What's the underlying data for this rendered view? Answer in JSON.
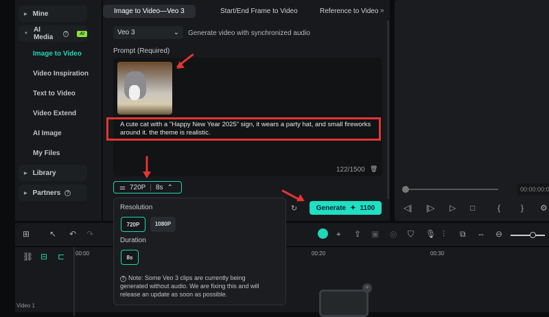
{
  "sidebar": {
    "groups": [
      {
        "label": "Mine"
      },
      {
        "label": "AI Media",
        "badge": "AI"
      },
      {
        "label": "Library"
      },
      {
        "label": "Partners"
      }
    ],
    "items": [
      {
        "label": "Image to Video"
      },
      {
        "label": "Video Inspiration"
      },
      {
        "label": "Text to Video"
      },
      {
        "label": "Video Extend"
      },
      {
        "label": "AI Image"
      },
      {
        "label": "My Files"
      }
    ]
  },
  "tabs": [
    {
      "label": "Image to Video—Veo 3"
    },
    {
      "label": "Start/End Frame to Video"
    },
    {
      "label": "Reference to Video"
    }
  ],
  "model": {
    "value": "Veo 3",
    "description": "Generate video with synchronized audio"
  },
  "prompt": {
    "label": "Prompt (Required)",
    "text": "A cute cat with a \"Happy New Year 2025\" sign, it wears a party hat, and small fireworks around it. the theme is realistic.",
    "counter": "122/1500"
  },
  "settings": {
    "resolution": "720P",
    "duration": "8s"
  },
  "generate": {
    "label": "Generate",
    "credits": "1100"
  },
  "popup": {
    "resolution_label": "Resolution",
    "resolutions": [
      "720P",
      "1080P"
    ],
    "duration_label": "Duration",
    "durations": [
      "8s"
    ],
    "note": "Note: Some Veo 3 clips are currently being generated without audio. We are fixing this and will release an update as soon as possible."
  },
  "preview": {
    "timecode": "00:00:00:0"
  },
  "timeline": {
    "ticks": [
      "00:00",
      "00:20",
      "00:30"
    ],
    "track": "Video 1"
  },
  "colors": {
    "accent": "#1fd6b8",
    "annotation": "#e63434"
  }
}
